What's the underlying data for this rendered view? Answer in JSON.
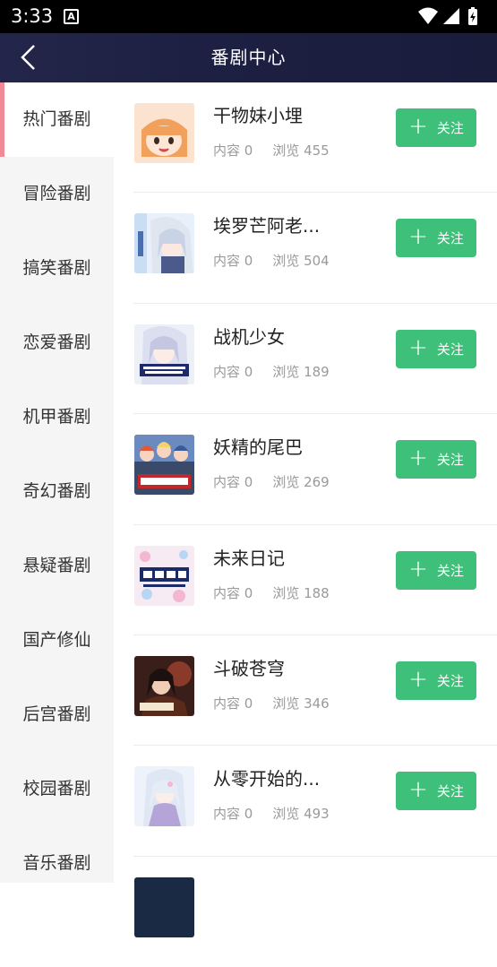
{
  "status_bar": {
    "time": "3:33",
    "notification_badge": "A"
  },
  "header": {
    "title": "番剧中心",
    "back_icon": "chevron-left-icon"
  },
  "sidebar": {
    "items": [
      {
        "label": "热门番剧",
        "active": true
      },
      {
        "label": "冒险番剧"
      },
      {
        "label": "搞笑番剧"
      },
      {
        "label": "恋爱番剧"
      },
      {
        "label": "机甲番剧"
      },
      {
        "label": "奇幻番剧"
      },
      {
        "label": "悬疑番剧"
      },
      {
        "label": "国产修仙"
      },
      {
        "label": "后宫番剧"
      },
      {
        "label": "校园番剧"
      },
      {
        "label": "音乐番剧"
      }
    ]
  },
  "list": {
    "items": [
      {
        "name": "干物妹小埋",
        "content": "内容 0",
        "views": "浏览 455",
        "follow": "关注"
      },
      {
        "name": "埃罗芒阿老...",
        "content": "内容 0",
        "views": "浏览 504",
        "follow": "关注"
      },
      {
        "name": "战机少女",
        "content": "内容 0",
        "views": "浏览 189",
        "follow": "关注"
      },
      {
        "name": "妖精的尾巴",
        "content": "内容 0",
        "views": "浏览 269",
        "follow": "关注"
      },
      {
        "name": "未来日记",
        "content": "内容 0",
        "views": "浏览 188",
        "follow": "关注"
      },
      {
        "name": "斗破苍穹",
        "content": "内容 0",
        "views": "浏览 346",
        "follow": "关注"
      },
      {
        "name": "从零开始的...",
        "content": "内容 0",
        "views": "浏览 493",
        "follow": "关注"
      }
    ]
  },
  "colors": {
    "accent_green": "#3fc07a",
    "active_indicator": "#f28a96",
    "header_bg": "#1d2042"
  }
}
